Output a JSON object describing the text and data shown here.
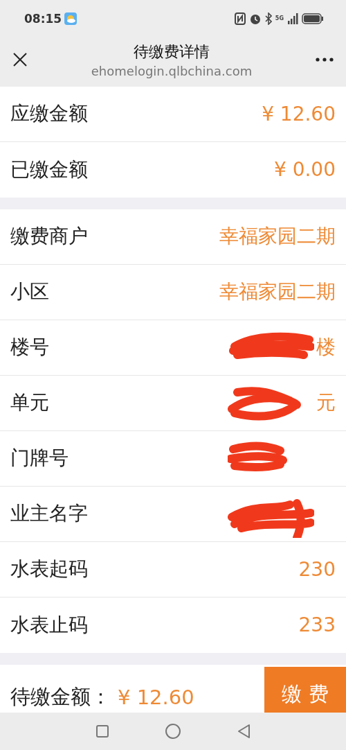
{
  "status_bar": {
    "time": "08:15",
    "network": "5G"
  },
  "header": {
    "title": "待缴费详情",
    "url": "ehomelogin.qlbchina.com"
  },
  "sections": [
    {
      "rows": [
        {
          "label": "应缴金额",
          "value": "¥ 12.60"
        },
        {
          "label": "已缴金额",
          "value": "¥ 0.00"
        }
      ]
    },
    {
      "rows": [
        {
          "label": "缴费商户",
          "value": "幸福家园二期"
        },
        {
          "label": "小区",
          "value": "幸福家园二期"
        },
        {
          "label": "楼号",
          "value": "楼",
          "redacted": true
        },
        {
          "label": "单元",
          "value": "元",
          "redacted": true
        },
        {
          "label": "门牌号",
          "redacted": true
        },
        {
          "label": "业主名字",
          "redacted": true
        },
        {
          "label": "水表起码",
          "value": "230"
        },
        {
          "label": "水表止码",
          "value": "233"
        }
      ]
    }
  ],
  "footer": {
    "label": "待缴金额：",
    "amount": "¥ 12.60",
    "button": "缴 费"
  }
}
